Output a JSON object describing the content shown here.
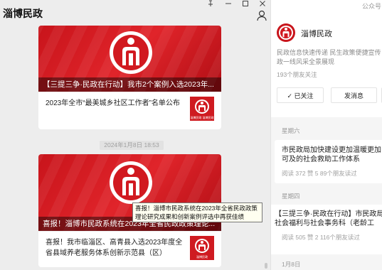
{
  "window": {
    "title": "淄博民政"
  },
  "feed": {
    "timestamp": "2024年1月8日 18:53",
    "cards": [
      {
        "hero_caption": "【三提三争·民政在行动】我市2个案例入选2023年...",
        "sub_title": "2023年全市“最美城乡社区工作者”名单公布",
        "thumb_caption": "淄博民政 淄博民政"
      },
      {
        "hero_caption": "喜报！淄博市民政系统在2023年全省民政政策理论...",
        "sub_title": "喜报！我市临淄区、高青县入选2023年度全省县域养老服务体系创新示范县（区）",
        "thumb_caption": "淄博民政"
      }
    ],
    "tooltip": "喜报！淄博市民政系统在2023年全省民政政策理论研究成果和创新案例评选中再获佳绩"
  },
  "profile": {
    "label": "公众号",
    "name": "淄博民政",
    "description": "民政信息快速传递 民生政策便捷宣传 民政一线风采全景展现",
    "friends": "193个朋友关注",
    "follow_label": "✓ 已关注",
    "message_label": "发消息",
    "posts": [
      {
        "date": "星期六",
        "title": "市民政局加快建设更加温暖更加可及的社会救助工作体系",
        "meta": "阅读 372  赞 5  89个朋友读过"
      },
      {
        "date": "星期四",
        "title": "【三提三争·民政在行动】市民政局社会福利与社会事务科（老龄工作）联合开展“感受警营风采，共建平安社区”活动",
        "meta": "阅读 505  赞 2  116个朋友读过"
      },
      {
        "date": "1月8日",
        "title": "",
        "meta": ""
      }
    ]
  },
  "colors": {
    "brand_red": "#c8141b",
    "panel_bg": "#ededed"
  }
}
